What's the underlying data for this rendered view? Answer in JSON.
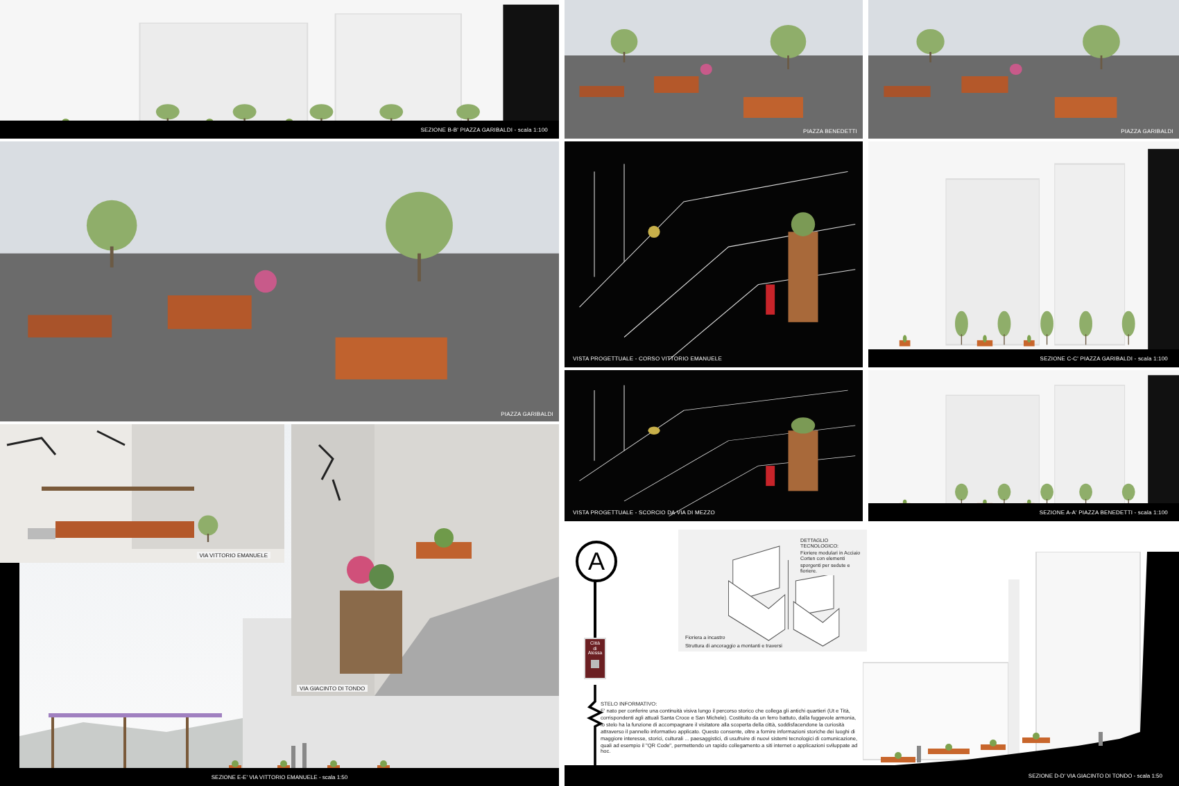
{
  "panels": [
    {
      "kind": "section",
      "caption": "SEZIONE B-B' PIAZZA GARIBALDI - scala 1:100"
    },
    {
      "kind": "render",
      "caption": "PIAZZA BENEDETTI"
    },
    {
      "kind": "render",
      "caption": "PIAZZA GARIBALDI"
    },
    {
      "kind": "render",
      "caption": "PIAZZA GARIBALDI"
    },
    {
      "kind": "night",
      "caption": "VISTA PROGETTUALE - CORSO VITTORIO EMANUELE"
    },
    {
      "kind": "section",
      "caption": "SEZIONE C-C' PIAZZA GARIBALDI - scala 1:100"
    },
    {
      "kind": "night",
      "caption": "VISTA PROGETTUALE - SCORCIO DA VIA DI MEZZO"
    },
    {
      "kind": "section",
      "caption": "SEZIONE A-A' PIAZZA BENEDETTI - scala 1:100"
    }
  ],
  "lower_left": {
    "renders": [
      {
        "caption": "VIA VITTORIO EMANUELE"
      },
      {
        "caption": "VIA GIACINTO DI TONDO"
      }
    ],
    "section_caption": "SEZIONE E-E' VIA VITTORIO EMANUELE - scala 1:50"
  },
  "lower_right": {
    "detail": {
      "title": "DETTAGLIO TECNOLOGICO:",
      "text": "Fioriere modulari in Acciaio Corten con elementi sporgenti per sedute e fioriere.",
      "labels": [
        "Fioriera a incastro",
        "Struttura di ancoraggio a montanti e traversi"
      ]
    },
    "stelo": {
      "letter": "A",
      "sign": [
        "Città",
        "di",
        "Atessa"
      ],
      "title": "STELO INFORMATIVO:",
      "text": "E' nato per conferire una continuità visiva lungo il percorso storico che collega gli antichi quartieri (Ut e Tità, corrispondenti agli attuali Santa Croce e San Michele). Costituito da un ferro battuto, dalla fuggevole armonia, lo stelo ha la funzione di accompagnare il visitatore alla scoperta della città, soddisfacendone la curiosità attraverso il pannello informativo applicato. Questo consente, oltre a fornire informazioni storiche dei luoghi di maggiore interesse, storici, culturali ... paesaggistici, di usufruire di nuovi sistemi tecnologici di comunicazione, quali ad esempio il \"QR Code\", permettendo un rapido collegamento a siti internet o applicazioni sviluppate ad hoc."
    },
    "section_caption": "SEZIONE D-D' VIA GIACINTO DI TONDO - scala 1:50"
  }
}
